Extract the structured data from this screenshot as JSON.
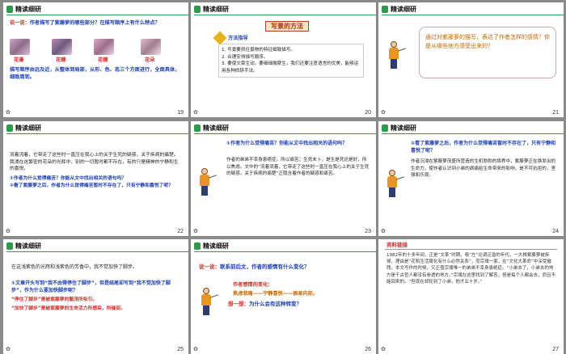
{
  "section_title": "精读细研",
  "s19": {
    "number": "19",
    "question_label": "说一说：",
    "question": "作者描写了紫藤萝的哪些部分？在描写顺序上有什么特点？",
    "labels": [
      "花瀑",
      "花穗",
      "花穗",
      "花朵"
    ],
    "answer": "描写顺序由远及近，从整体到局部，从形、色、态三个方面进行，全面具体，细致周到。"
  },
  "s20": {
    "number": "20",
    "banner": "写景的方法",
    "guide_title": "方法指导",
    "lines": [
      "1. 写景要抓住景物的特征细致描写。",
      "2. 合理安排描写顺序。",
      "3. 要使文章生动，要细细揣摩生，我们还要注意语言的优美，能够运用各种修辞手法。"
    ]
  },
  "s21": {
    "number": "21",
    "question": "通过对紫藤萝的描写，表达了作者怎样的感情？你是从哪些地方感受出来的？"
  },
  "s22": {
    "number": "22",
    "para": "流着流着，它带走了这些时一直压在我心上的关于生死的疑惑，关于疾病的痛楚。我浸在这繁密的花朵的光辉中，别的一切暂时都不存在，有的只是精神的宁静和生的喜悦。",
    "q1": "①作者为什么觉得痛苦？你能从文中找出相关的语句吗？",
    "q2": "②看了紫藤萝之后，作者为什么觉得痛苦暂时不存在了，只有宁静和喜悦了呢？"
  },
  "s23": {
    "number": "23",
    "q": "①作者为什么觉得痛苦？你能从文中找出相关的语句吗？",
    "answer": "作者的弟弟不幸身患绝症，所以痛苦；生死未卜，是生是死还是好，所以焦虑。文中的“流着流着，它带走了这些时一直压在我心上的关于生死的疑惑，关于疾病的痛楚”正隐含着作者的疑惑和痛苦。"
  },
  "s24": {
    "number": "24",
    "q": "②看了紫藤萝之后，作者为什么觉得痛苦暂时不存在了，只有宁静和喜悦了呢？",
    "answer": "作者沉浸在紫藤萝茂盛所营造的生机勃勃的境界中，紫藤萝正在焕发出的生命力，使作者认识到小弟的病痛给生命带来的影响，是不可抗拒的，坚强和乐观。"
  },
  "s25": {
    "number": "25",
    "para": "在这浅紫色的光辉和浅紫色的芳香中，我不觉加快了脚步。",
    "q": "①文章开头写到“我不由得停住了脚步”，但是结尾却写到“我不觉加快了脚步”，作为什么要加快脚步呢？",
    "a1": "“停住了脚步”是被紫藤萝的繁茂所吸引。",
    "a2": "“加快了脚步”是被紫藤萝的生命活力所感染，所催促。"
  },
  "s26": {
    "number": "26",
    "q_label": "说一说：",
    "q": "联系前后文，作者的感情有什么变化？",
    "change_label": "作者感情的变化：",
    "change": "焦虑悲痛——宁静喜悦——振奋向前。",
    "think_label": "想一想：",
    "think": "为什么会有这种转变？"
  },
  "s27": {
    "number": "27",
    "heading": "资料链接",
    "para": "1982年的十多年间，正是“文革”时期，极“左”论调泛滥的年代，一大株紫藤萝被拆掉，理由是“花和生活腐化有什么必然关系”，而宗璞一家，在“文化大革命”中深受摧残。本文写作的时候，又正值宗璞唯一的弟弟不幸身患绝症。“小弟去了，小弟去的地方是千古哲人都没有参透的地方。”宗璞在这里找到了解答，但是每个人都会去，而且不能回来的。“但现在却轮到了小弟，他才五十岁。”"
  }
}
